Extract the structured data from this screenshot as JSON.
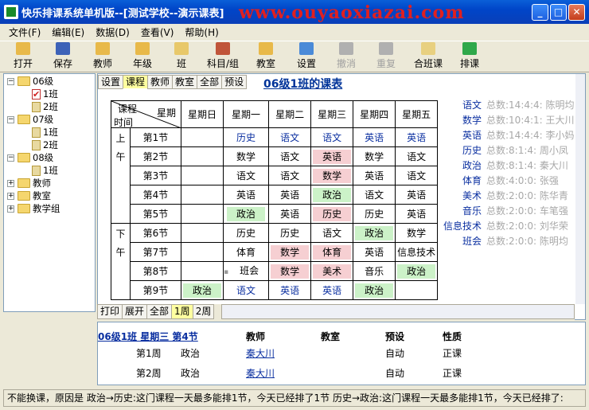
{
  "window": {
    "title": "快乐排课系统单机版--[测试学校--演示课表]",
    "watermark": "www.ouyaoxiazai.com"
  },
  "menu": [
    "文件(F)",
    "编辑(E)",
    "数据(D)",
    "查看(V)",
    "帮助(H)"
  ],
  "toolbar": [
    {
      "label": "打开",
      "icon": "folder-open-icon",
      "color": "#e8b94a",
      "enabled": true
    },
    {
      "label": "保存",
      "icon": "floppy-save-icon",
      "color": "#3d62b8",
      "enabled": true
    },
    {
      "label": "教师",
      "icon": "teacher-icon",
      "color": "#e8b94a",
      "enabled": true
    },
    {
      "label": "年级",
      "icon": "grade-icon",
      "color": "#e8b94a",
      "enabled": true
    },
    {
      "label": "班",
      "icon": "class-icon",
      "color": "#e8c86a",
      "enabled": true
    },
    {
      "label": "科目/组",
      "icon": "people-icon",
      "color": "#c0553a",
      "enabled": true
    },
    {
      "label": "教室",
      "icon": "classroom-icon",
      "color": "#e8b94a",
      "enabled": true
    },
    {
      "label": "设置",
      "icon": "gear-icon",
      "color": "#4a8ad8",
      "enabled": true
    },
    {
      "label": "撤消",
      "icon": "undo-icon",
      "color": "#b0b0b0",
      "enabled": false
    },
    {
      "label": "重复",
      "icon": "redo-icon",
      "color": "#b0b0b0",
      "enabled": false
    },
    {
      "label": "合班课",
      "icon": "merge-class-icon",
      "color": "#e8d080",
      "enabled": true
    },
    {
      "label": "排课",
      "icon": "schedule-run-icon",
      "color": "#2fa84a",
      "enabled": true
    }
  ],
  "tree": [
    {
      "label": "06级",
      "kind": "folder",
      "expander": "−"
    },
    {
      "label": "1班",
      "kind": "checked",
      "expander": ""
    },
    {
      "label": "2班",
      "kind": "doc",
      "expander": ""
    },
    {
      "label": "07级",
      "kind": "folder",
      "expander": "−"
    },
    {
      "label": "1班",
      "kind": "doc",
      "expander": ""
    },
    {
      "label": "2班",
      "kind": "doc",
      "expander": ""
    },
    {
      "label": "08级",
      "kind": "folder",
      "expander": "−"
    },
    {
      "label": "1班",
      "kind": "doc",
      "expander": ""
    },
    {
      "label": "教师",
      "kind": "folder",
      "expander": "+"
    },
    {
      "label": "教室",
      "kind": "folder",
      "expander": "+"
    },
    {
      "label": "教学组",
      "kind": "folder",
      "expander": "+"
    }
  ],
  "view_tabs": [
    {
      "label": "设置",
      "active": false
    },
    {
      "label": "课程",
      "active": true
    },
    {
      "label": "教师",
      "active": false
    },
    {
      "label": "教室",
      "active": false
    },
    {
      "label": "全部",
      "active": false
    },
    {
      "label": "预设",
      "active": false
    }
  ],
  "sheet_title": "06级1班的课表",
  "timetable": {
    "corner_top": "课程",
    "corner_mid": "星期",
    "corner_bottom": "时间",
    "days": [
      "星期日",
      "星期一",
      "星期二",
      "星期三",
      "星期四",
      "星期五"
    ],
    "morning_label": [
      "上",
      "午"
    ],
    "afternoon_label": [
      "下",
      "午"
    ],
    "rows": [
      {
        "slot": "第1节",
        "cells": [
          {
            "t": "",
            "s": ""
          },
          {
            "t": "历史",
            "s": "blue"
          },
          {
            "t": "语文",
            "s": "blue"
          },
          {
            "t": "语文",
            "s": "blue"
          },
          {
            "t": "英语",
            "s": "blue"
          },
          {
            "t": "英语",
            "s": "blue"
          }
        ]
      },
      {
        "slot": "第2节",
        "cells": [
          {
            "t": "",
            "s": ""
          },
          {
            "t": "数学",
            "s": ""
          },
          {
            "t": "语文",
            "s": ""
          },
          {
            "t": "英语",
            "s": "pink"
          },
          {
            "t": "数学",
            "s": ""
          },
          {
            "t": "语文",
            "s": ""
          }
        ]
      },
      {
        "slot": "第3节",
        "cells": [
          {
            "t": "",
            "s": ""
          },
          {
            "t": "语文",
            "s": ""
          },
          {
            "t": "语文",
            "s": ""
          },
          {
            "t": "数学",
            "s": "pink"
          },
          {
            "t": "英语",
            "s": ""
          },
          {
            "t": "语文",
            "s": ""
          }
        ]
      },
      {
        "slot": "第4节",
        "cells": [
          {
            "t": "",
            "s": ""
          },
          {
            "t": "英语",
            "s": ""
          },
          {
            "t": "英语",
            "s": ""
          },
          {
            "t": "政治",
            "s": "green"
          },
          {
            "t": "语文",
            "s": ""
          },
          {
            "t": "英语",
            "s": ""
          }
        ]
      },
      {
        "slot": "第5节",
        "cells": [
          {
            "t": "",
            "s": ""
          },
          {
            "t": "政治",
            "s": "green"
          },
          {
            "t": "英语",
            "s": ""
          },
          {
            "t": "历史",
            "s": "pink"
          },
          {
            "t": "历史",
            "s": ""
          },
          {
            "t": "英语",
            "s": ""
          }
        ]
      },
      {
        "slot": "第6节",
        "cells": [
          {
            "t": "",
            "s": ""
          },
          {
            "t": "历史",
            "s": ""
          },
          {
            "t": "历史",
            "s": ""
          },
          {
            "t": "语文",
            "s": ""
          },
          {
            "t": "政治",
            "s": "green"
          },
          {
            "t": "数学",
            "s": ""
          }
        ]
      },
      {
        "slot": "第7节",
        "cells": [
          {
            "t": "",
            "s": ""
          },
          {
            "t": "体育",
            "s": ""
          },
          {
            "t": "数学",
            "s": "pink"
          },
          {
            "t": "体育",
            "s": "pink"
          },
          {
            "t": "英语",
            "s": ""
          },
          {
            "t": "信息技术",
            "s": ""
          }
        ]
      },
      {
        "slot": "第8节",
        "cells": [
          {
            "t": "",
            "s": ""
          },
          {
            "t": "班会",
            "s": "lock"
          },
          {
            "t": "数学",
            "s": "pink"
          },
          {
            "t": "美术",
            "s": "pink"
          },
          {
            "t": "音乐",
            "s": ""
          },
          {
            "t": "政治",
            "s": "green"
          }
        ]
      },
      {
        "slot": "第9节",
        "cells": [
          {
            "t": "政治",
            "s": "green"
          },
          {
            "t": "语文",
            "s": "blue"
          },
          {
            "t": "英语",
            "s": "blue"
          },
          {
            "t": "英语",
            "s": "blue"
          },
          {
            "t": "政治",
            "s": "green"
          },
          {
            "t": "",
            "s": ""
          }
        ]
      }
    ]
  },
  "subjects": [
    {
      "name": "语文",
      "stats": "总数:14:4:4: 陈明均"
    },
    {
      "name": "数学",
      "stats": "总数:10:4:1: 王大川"
    },
    {
      "name": "英语",
      "stats": "总数:14:4:4: 李小妈"
    },
    {
      "name": "历史",
      "stats": "总数:8:1:4: 周小凤"
    },
    {
      "name": "政治",
      "stats": "总数:8:1:4: 秦大川"
    },
    {
      "name": "体育",
      "stats": "总数:4:0:0: 张强"
    },
    {
      "name": "美术",
      "stats": "总数:2:0:0: 陈华青"
    },
    {
      "name": "音乐",
      "stats": "总数:2:0:0: 车笔强"
    },
    {
      "name": "信息技术",
      "stats": "总数:2:0:0: 刘华荣"
    },
    {
      "name": "班会",
      "stats": "总数:2:0:0: 陈明均"
    }
  ],
  "bottom_tabs": [
    {
      "label": "打印",
      "active": false
    },
    {
      "label": "展开",
      "active": false
    },
    {
      "label": "全部",
      "active": false
    },
    {
      "label": "1周",
      "active": true
    },
    {
      "label": "2周",
      "active": false
    }
  ],
  "detail": {
    "heading": "06级1班 星期三 第4节",
    "col_teacher": "教师",
    "col_room": "教室",
    "col_preset": "预设",
    "col_type": "性质",
    "rows": [
      {
        "week": "第1周",
        "subject": "政治",
        "teacher": "秦大川",
        "room": "",
        "preset": "自动",
        "type": "正课"
      },
      {
        "week": "第2周",
        "subject": "政治",
        "teacher": "秦大川",
        "room": "",
        "preset": "自动",
        "type": "正课"
      }
    ]
  },
  "status": "不能换课，原因是 政治→历史:这门课程一天最多能排1节，今天已经排了1节 历史→政治:这门课程一天最多能排1节，今天已经排了:"
}
